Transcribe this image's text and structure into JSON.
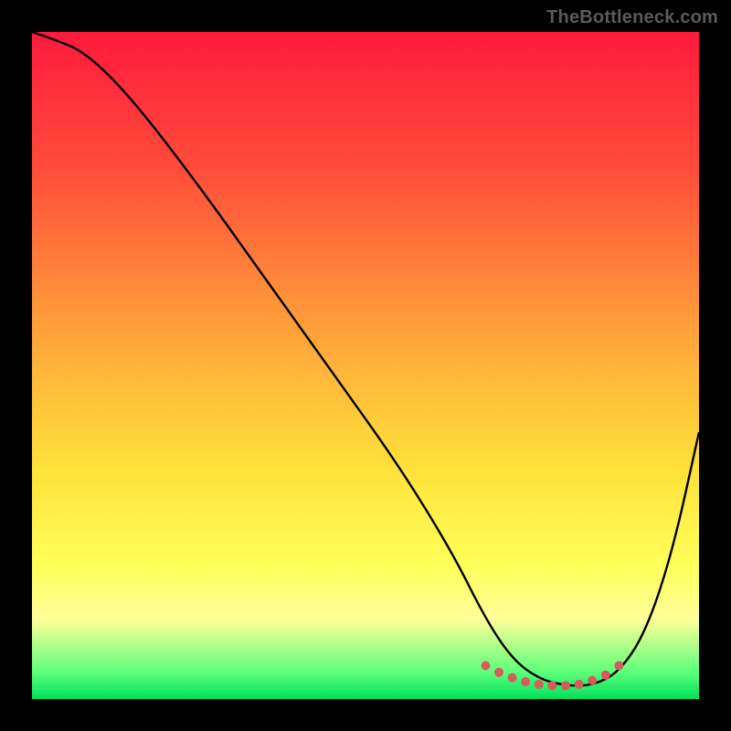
{
  "watermark": "TheBottleneck.com",
  "chart_data": {
    "type": "line",
    "title": "",
    "xlabel": "",
    "ylabel": "",
    "xlim": [
      0,
      100
    ],
    "ylim": [
      0,
      100
    ],
    "background_gradient": [
      "#ff1a3d",
      "#ffff5a",
      "#00e05a"
    ],
    "series": [
      {
        "name": "bottleneck-curve",
        "x": [
          0,
          3,
          8,
          15,
          25,
          35,
          45,
          55,
          63,
          68,
          72,
          76,
          80,
          84,
          88,
          92,
          96,
          100
        ],
        "y": [
          100,
          99,
          97,
          90,
          77,
          63,
          49,
          35,
          22,
          12,
          6,
          3,
          2,
          2,
          4,
          10,
          22,
          40
        ]
      }
    ],
    "markers": {
      "name": "optimal-range",
      "x": [
        68,
        70,
        72,
        74,
        76,
        78,
        80,
        82,
        84,
        86,
        88
      ],
      "y": [
        5,
        4,
        3.2,
        2.6,
        2.2,
        2.0,
        2.0,
        2.2,
        2.8,
        3.6,
        5
      ]
    }
  }
}
